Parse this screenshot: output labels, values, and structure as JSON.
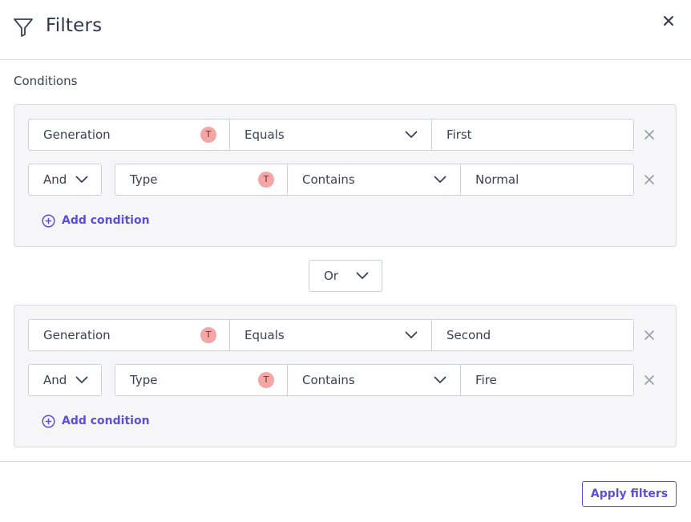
{
  "header": {
    "title": "Filters",
    "filter_icon": "filter-funnel-icon",
    "close_icon": "close-icon"
  },
  "conditions_label": "Conditions",
  "groups": [
    {
      "rows": [
        {
          "field": "Generation",
          "field_type_badge": "T",
          "operator": "Equals",
          "value": "First"
        },
        {
          "conjunction": "And",
          "field": "Type",
          "field_type_badge": "T",
          "operator": "Contains",
          "value": "Normal"
        }
      ],
      "add_condition_label": "Add condition"
    },
    {
      "rows": [
        {
          "field": "Generation",
          "field_type_badge": "T",
          "operator": "Equals",
          "value": "Second"
        },
        {
          "conjunction": "And",
          "field": "Type",
          "field_type_badge": "T",
          "operator": "Contains",
          "value": "Fire"
        }
      ],
      "add_condition_label": "Add condition"
    }
  ],
  "group_joiner": "Or",
  "footer": {
    "apply_label": "Apply filters"
  },
  "colors": {
    "accent": "#5b4fd6",
    "badge": "#f3a6a6",
    "border": "#cdd0d8",
    "group_bg": "#f6f6f8"
  }
}
